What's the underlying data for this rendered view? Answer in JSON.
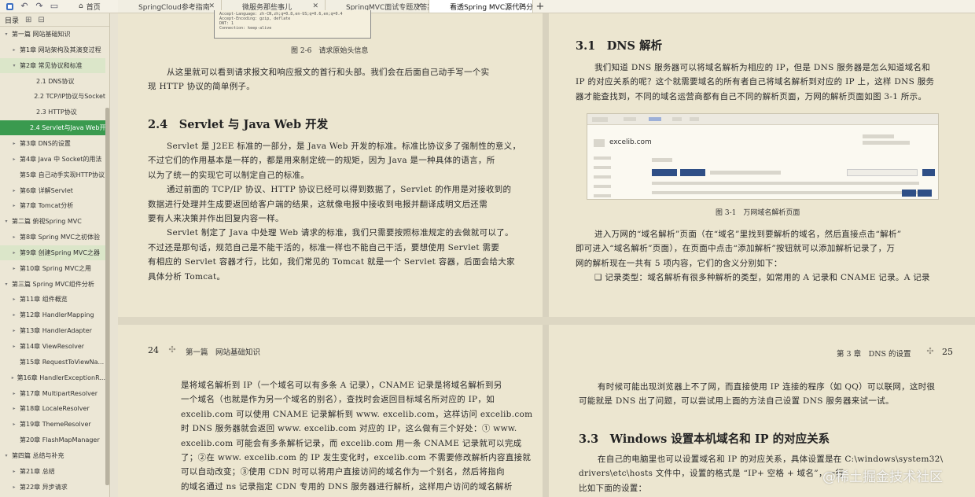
{
  "toolbar": {
    "icons": [
      "app-icon",
      "undo-icon",
      "redo-icon",
      "bookmark-icon"
    ],
    "home_label": "首页"
  },
  "tabs": [
    {
      "label": "SpringCloud参考指南",
      "active": false
    },
    {
      "label": "微服务那些事儿",
      "active": false
    },
    {
      "label": "SpringMVC面试专题及答案 *",
      "active": false
    },
    {
      "label": "看透Spring MVC源代码分析...",
      "active": true
    }
  ],
  "sidebar": {
    "title": "目录",
    "items": [
      {
        "label": "第一篇 网站基础知识",
        "level": 0,
        "arrow": "▾"
      },
      {
        "label": "第1章  网站架构及其演变过程",
        "level": 1,
        "arrow": "▸"
      },
      {
        "label": "第2章  常见协议和标准",
        "level": 1,
        "arrow": "▾",
        "highlight": true
      },
      {
        "label": "2.1  DNS协议",
        "level": 2,
        "arrow": ""
      },
      {
        "label": "2.2  TCP/IP协议与Socket",
        "level": 2,
        "arrow": ""
      },
      {
        "label": "2.3  HTTP协议",
        "level": 2,
        "arrow": ""
      },
      {
        "label": "2.4  Servlet与Java Web开发",
        "level": 2,
        "arrow": "",
        "selected": true
      },
      {
        "label": "第3章  DNS的设置",
        "level": 1,
        "arrow": "▸"
      },
      {
        "label": "第4章  Java 中 Socket的用法",
        "level": 1,
        "arrow": "▸"
      },
      {
        "label": "第5章  自己动手实现HTTP协议",
        "level": 1,
        "arrow": ""
      },
      {
        "label": "第6章  详解Servlet",
        "level": 1,
        "arrow": "▸"
      },
      {
        "label": "第7章  Tomcat分析",
        "level": 1,
        "arrow": "▸"
      },
      {
        "label": "第二篇  俯视Spring MVC",
        "level": 0,
        "arrow": "▾"
      },
      {
        "label": "第8章  Spring MVC之初体验",
        "level": 1,
        "arrow": "▸"
      },
      {
        "label": "第9章  创建Spring MVC之器",
        "level": 1,
        "arrow": "▸",
        "highlight": true
      },
      {
        "label": "第10章  Spring MVC之用",
        "level": 1,
        "arrow": "▸"
      },
      {
        "label": "第三篇  Spring MVC组件分析",
        "level": 0,
        "arrow": "▾"
      },
      {
        "label": "第11章  组件概览",
        "level": 1,
        "arrow": "▸"
      },
      {
        "label": "第12章  HandlerMapping",
        "level": 1,
        "arrow": "▸"
      },
      {
        "label": "第13章  HandlerAdapter",
        "level": 1,
        "arrow": "▸"
      },
      {
        "label": "第14章  ViewResolver",
        "level": 1,
        "arrow": "▸"
      },
      {
        "label": "第15章  RequestToViewNa...",
        "level": 1,
        "arrow": ""
      },
      {
        "label": "第16章  HandlerExceptionR...",
        "level": 1,
        "arrow": "▸"
      },
      {
        "label": "第17章  MultipartResolver",
        "level": 1,
        "arrow": "▸"
      },
      {
        "label": "第18章  LocaleResolver",
        "level": 1,
        "arrow": "▸"
      },
      {
        "label": "第19章  ThemeResolver",
        "level": 1,
        "arrow": "▸"
      },
      {
        "label": "第20章  FlashMapManager",
        "level": 1,
        "arrow": ""
      },
      {
        "label": "第四篇  总结与补充",
        "level": 0,
        "arrow": "▾"
      },
      {
        "label": "第21章  总结",
        "level": 1,
        "arrow": "▸"
      },
      {
        "label": "第22章  异步请求",
        "level": 1,
        "arrow": "▸"
      }
    ]
  },
  "page1": {
    "code_lines": [
      "Accept-Language: zh-CN,zh;q=0.8,en-US;q=0.6,en;q=0.4",
      "Accept-Encoding: gzip, deflate",
      "DNT: 1",
      "Connection: keep-alive"
    ],
    "figure_caption": "图 2-6　请求原始头信息",
    "para1": [
      "从这里就可以看到请求报文和响应报文的首行和头部。我们会在后面自己动手写一个实",
      "现 HTTP 协议的简单例子。"
    ],
    "heading": "2.4　Servlet 与 Java Web 开发",
    "para2": [
      "Servlet 是 J2EE 标准的一部分，是 Java Web 开发的标准。标准比协议多了强制性的意义，",
      "不过它们的作用基本是一样的，都是用来制定统一的规矩，因为 Java 是一种具体的语言，所",
      "以为了统一的实现它可以制定自己的标准。"
    ],
    "para3": [
      "通过前面的 TCP/IP 协议、HTTP 协议已经可以得到数据了，Servlet 的作用是对接收到的",
      "数据进行处理并生成要返回给客户端的结果，这就像电报中接收到电报并翻译成明文后还需",
      "要有人来决策并作出回复内容一样。"
    ],
    "para4": [
      "Servlet 制定了 Java 中处理 Web 请求的标准，我们只需要按照标准规定的去做就可以了。",
      "不过还是那句话，规范自己是不能干活的，标准一样也不能自己干活，要想使用 Servlet 需要",
      "有相应的 Servlet 容器才行，比如，我们常见的 Tomcat 就是一个 Servlet 容器，后面会给大家",
      "具体分析 Tomcat。"
    ]
  },
  "page2": {
    "heading": "3.1　DNS 解析",
    "para1": [
      "我们知道 DNS 服务器可以将域名解析为相应的 IP，但是 DNS 服务器是怎么知道域名和",
      "IP 的对应关系的呢？这个就需要域名的所有者自己将域名解析到对应的 IP 上，这样 DNS 服务",
      "器才能查找到，不同的域名运营商都有自己不同的解析页面，万网的解析页面如图 3-1 所示。"
    ],
    "figure_domain": "excelib.com",
    "figure_caption": "图 3-1　万网域名解析页面",
    "para2": [
      "进入万网的“域名解析”页面（在“域名”里找到要解析的域名，然后直接点击“解析”",
      "即可进入“域名解析”页面），在页面中点击“添加解析”按钮就可以添加解析记录了，万",
      "网的解析现在一共有 5 项内容，它们的含义分别如下："
    ],
    "bullet": "❑  记录类型：域名解析有很多种解析的类型，如常用的 A 记录和 CNAME 记录。A 记录"
  },
  "page3": {
    "page_number": "24",
    "running_head": "第一篇　网站基础知识",
    "para": [
      "是将域名解析到 IP（一个域名可以有多条 A 记录），CNAME 记录是将域名解析到另",
      "一个域名（也就是作为另一个域名的别名），查找时会返回目标域名所对应的 IP，如",
      "excelib.com 可以使用 CNAME 记录解析到 www. excelib.com，这样访问 excelib.com",
      "时 DNS 服务器就会返回 www. excelib.com 对应的 IP，这么做有三个好处：① www.",
      "excelib.com 可能会有多条解析记录，而 excelib.com 用一条 CNAME 记录就可以完成",
      "了；②在 www. excelib.com 的 IP 发生变化时，excelib.com 不需要修改解析内容直接就",
      "可以自动改变；③使用 CDN 时可以将用户直接访问的域名作为一个别名，然后将指向",
      "的域名通过 ns 记录指定 CDN 专用的 DNS 服务器进行解析，这样用户访问的域名解析"
    ]
  },
  "page4": {
    "running_head": "第 3 章　DNS 的设置",
    "page_number": "25",
    "para1": [
      "有时候可能出现浏览器上不了网，而直接使用 IP 连接的程序（如 QQ）可以联网，这时很",
      "可能就是 DNS 出了问题，可以尝试用上面的方法自己设置 DNS 服务器来试一试。"
    ],
    "heading": "3.3　Windows 设置本机域名和 IP 的对应关系",
    "para2": [
      "在自己的电脑里也可以设置域名和 IP 的对应关系，具体设置是在 C:\\windows\\system32\\",
      "drivers\\etc\\hosts 文件中，设置的格式是 “IP+ 空格 + 域名”，一行",
      "比如下面的设置："
    ]
  },
  "watermark": "@稀土掘金技术社区"
}
